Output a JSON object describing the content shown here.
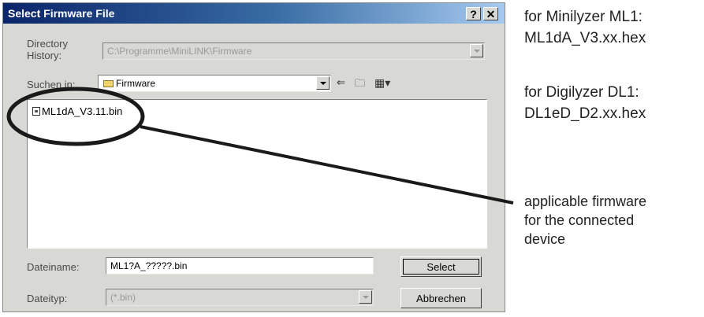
{
  "dialog": {
    "title": "Select Firmware File",
    "help_label": "?",
    "close_label": "✕",
    "directory_history_label": "Directory\nHistory:",
    "directory_history_value": "C:\\Programme\\MiniLINK\\Firmware",
    "search_in_label": "Suchen in:",
    "search_in_value": "Firmware",
    "files": [
      "ML1dA_V3.11.bin"
    ],
    "filename_label": "Dateiname:",
    "filename_value": "ML1?A_?????.bin",
    "filetype_label": "Dateityp:",
    "filetype_value": "(*.bin)",
    "select_button": "Select",
    "cancel_button": "Abbrechen"
  },
  "annotations": {
    "minilyzer_line1": "for Minilyzer ML1:",
    "minilyzer_line2": "ML1dA_V3.xx.hex",
    "digilyzer_line1": "for Digilyzer DL1:",
    "digilyzer_line2": "DL1eD_D2.xx.hex",
    "note_line1": "applicable firmware",
    "note_line2": "for the connected",
    "note_line3": "device"
  },
  "colors": {
    "titlebar_start": "#0a246a",
    "titlebar_end": "#a6caf0",
    "dialog_bg": "#d8d8d4"
  },
  "icons": {
    "back": "back-arrow-icon",
    "up_folder": "up-folder-icon",
    "view_menu": "view-menu-icon",
    "folder": "folder-icon",
    "file": "file-icon"
  }
}
